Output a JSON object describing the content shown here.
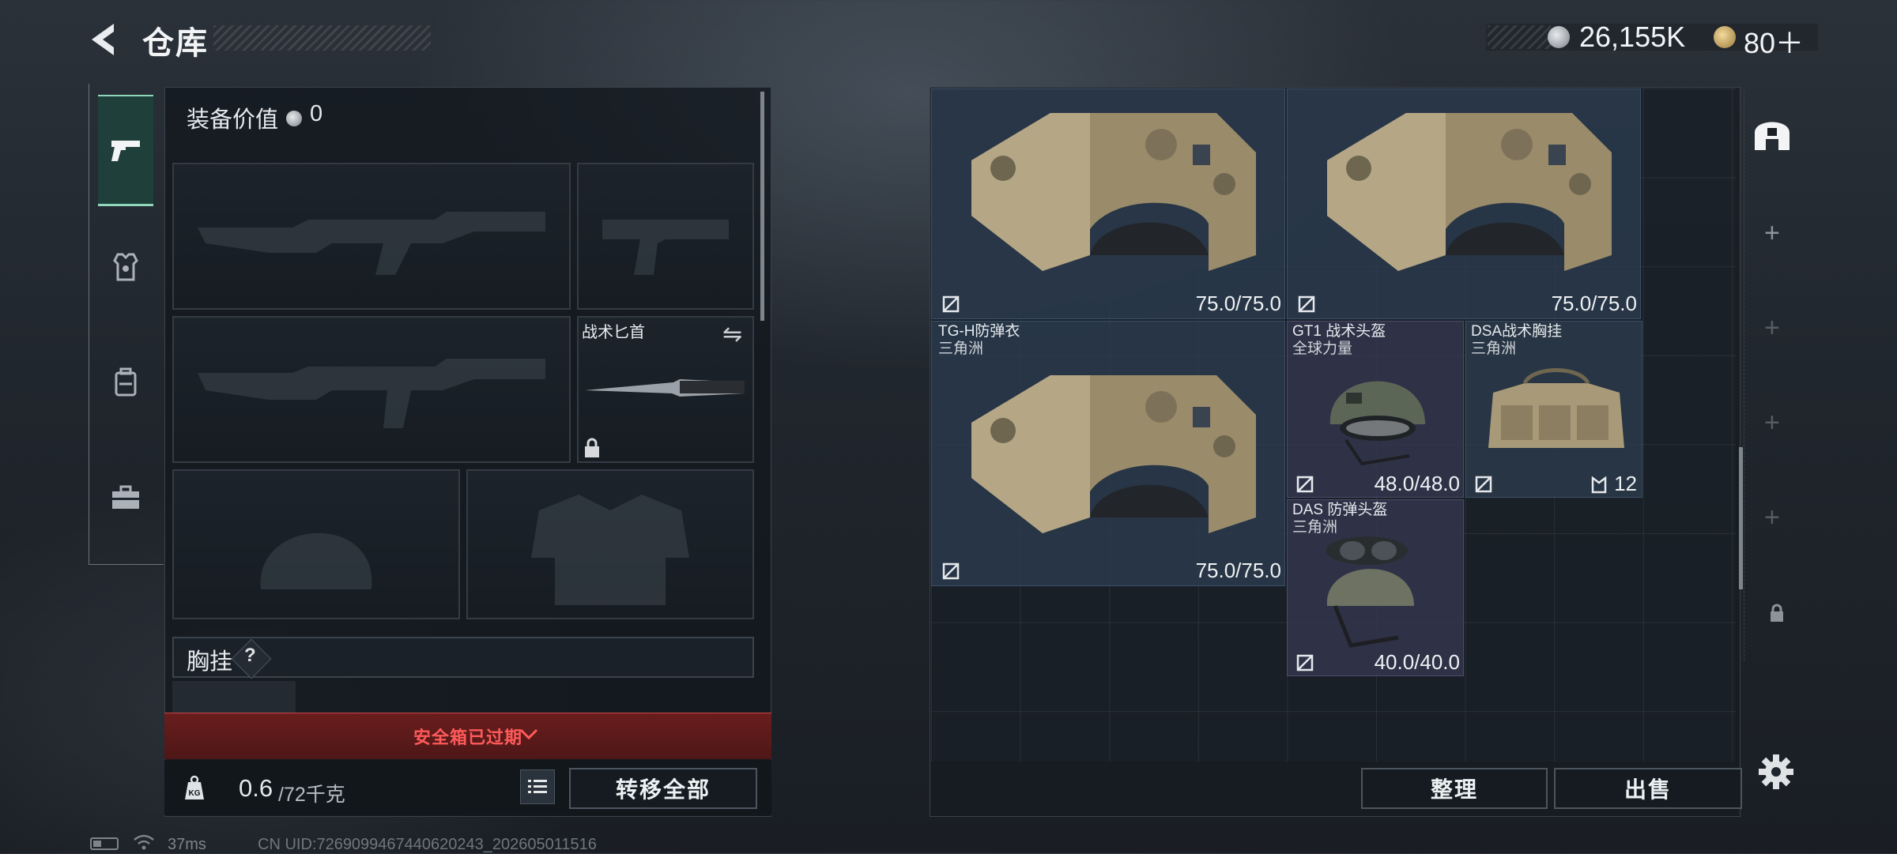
{
  "header": {
    "title": "仓库",
    "money": "26,155K",
    "tokens": "80＋"
  },
  "tabs": [
    "weapon",
    "armor",
    "backpack",
    "case"
  ],
  "loadout": {
    "equip_value_label": "装备价值",
    "equip_value": "0",
    "melee_label": "战术匕首",
    "chest_rig_label": "胸挂",
    "help": "?",
    "expired_notice": "安全箱已过期",
    "weight_value": "0.6",
    "weight_capacity": "/72千克",
    "transfer_all": "转移全部"
  },
  "status_bar": {
    "ping": "37ms",
    "uid": "CN UID:7269099467440620243_202605011516"
  },
  "storage": {
    "items": [
      {
        "name": "",
        "source": "",
        "value": "75.0/75.0"
      },
      {
        "name": "",
        "source": "",
        "value": "75.0/75.0"
      },
      {
        "name": "TG-H防弹衣",
        "source": "三角洲",
        "value": "75.0/75.0"
      },
      {
        "name": "GT1 战术头盔",
        "source": "全球力量",
        "value": "48.0/48.0"
      },
      {
        "name": "DSA战术胸挂",
        "source": "三角洲",
        "value": "12"
      },
      {
        "name": "DAS 防弹头盔",
        "source": "三角洲",
        "value": "40.0/40.0"
      }
    ],
    "tidy": "整理",
    "sell": "出售"
  },
  "colors": {
    "accent": "#8fd6bb",
    "warning": "#ff5a5a",
    "vest_bg": "#2a3a4c",
    "helmet_bg": "#34364e"
  }
}
